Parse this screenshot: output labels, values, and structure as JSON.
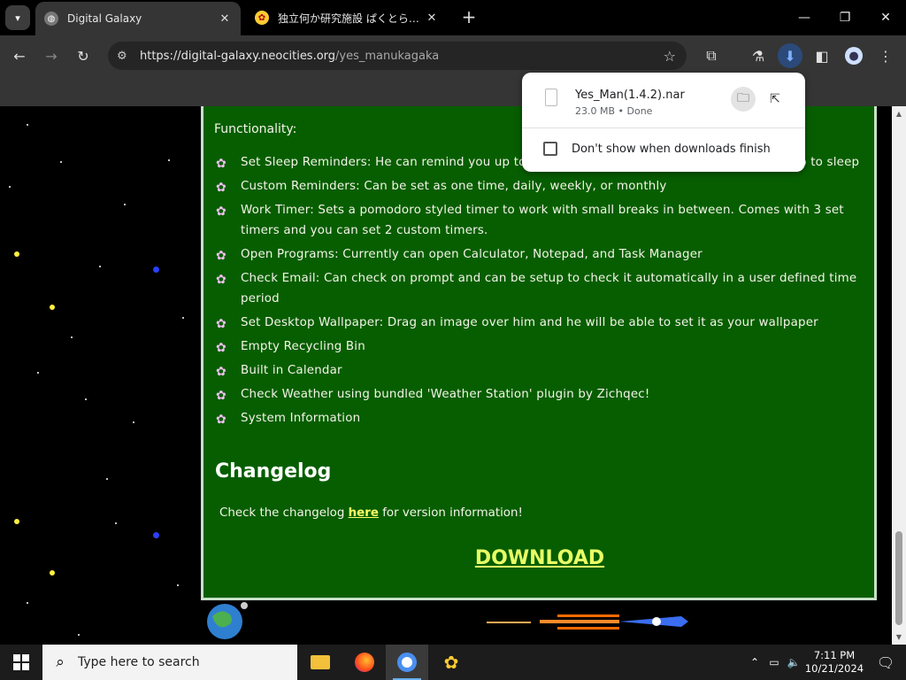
{
  "browser": {
    "tabs": [
      {
        "title": "Digital Galaxy",
        "active": true
      },
      {
        "title": "独立何か研究施設 ぱくとら研究所",
        "active": false
      }
    ],
    "url": {
      "host": "https://digital-galaxy.neocities.org",
      "path": "/yes_manukagaka"
    }
  },
  "page": {
    "functionality_label": "Functionality:",
    "features": [
      "Set Sleep Reminders: He can remind you up to an hour before the bedtime you choose to go to sleep",
      "Custom Reminders: Can be set as one time, daily, weekly, or monthly",
      "Work Timer: Sets a pomodoro styled timer to work with small breaks in between. Comes with 3 set timers and you can set 2 custom timers.",
      "Open Programs: Currently can open Calculator, Notepad, and Task Manager",
      "Check Email: Can check on prompt and can be setup to check it automatically in a user defined time period",
      "Set Desktop Wallpaper: Drag an image over him and he will be able to set it as your wallpaper",
      "Empty Recycling Bin",
      "Built in Calendar",
      "Check Weather using bundled 'Weather Station' plugin by Zichqec!",
      "System Information"
    ],
    "changelog_heading": "Changelog",
    "changelog_pre": "Check the changelog ",
    "changelog_link": "here",
    "changelog_post": " for version information!",
    "download_label": "DOWNLOAD"
  },
  "downloads": {
    "file_name": "Yes_Man(1.4.2).nar",
    "file_meta": "23.0 MB • Done",
    "checkbox_label": "Don't show when downloads finish"
  },
  "taskbar": {
    "search_placeholder": "Type here to search",
    "time": "7:11 PM",
    "date": "10/21/2024"
  },
  "colors": {
    "page_green": "#075e00",
    "download_yellow": "#e8ff66",
    "link_yellow": "#ffff66"
  }
}
